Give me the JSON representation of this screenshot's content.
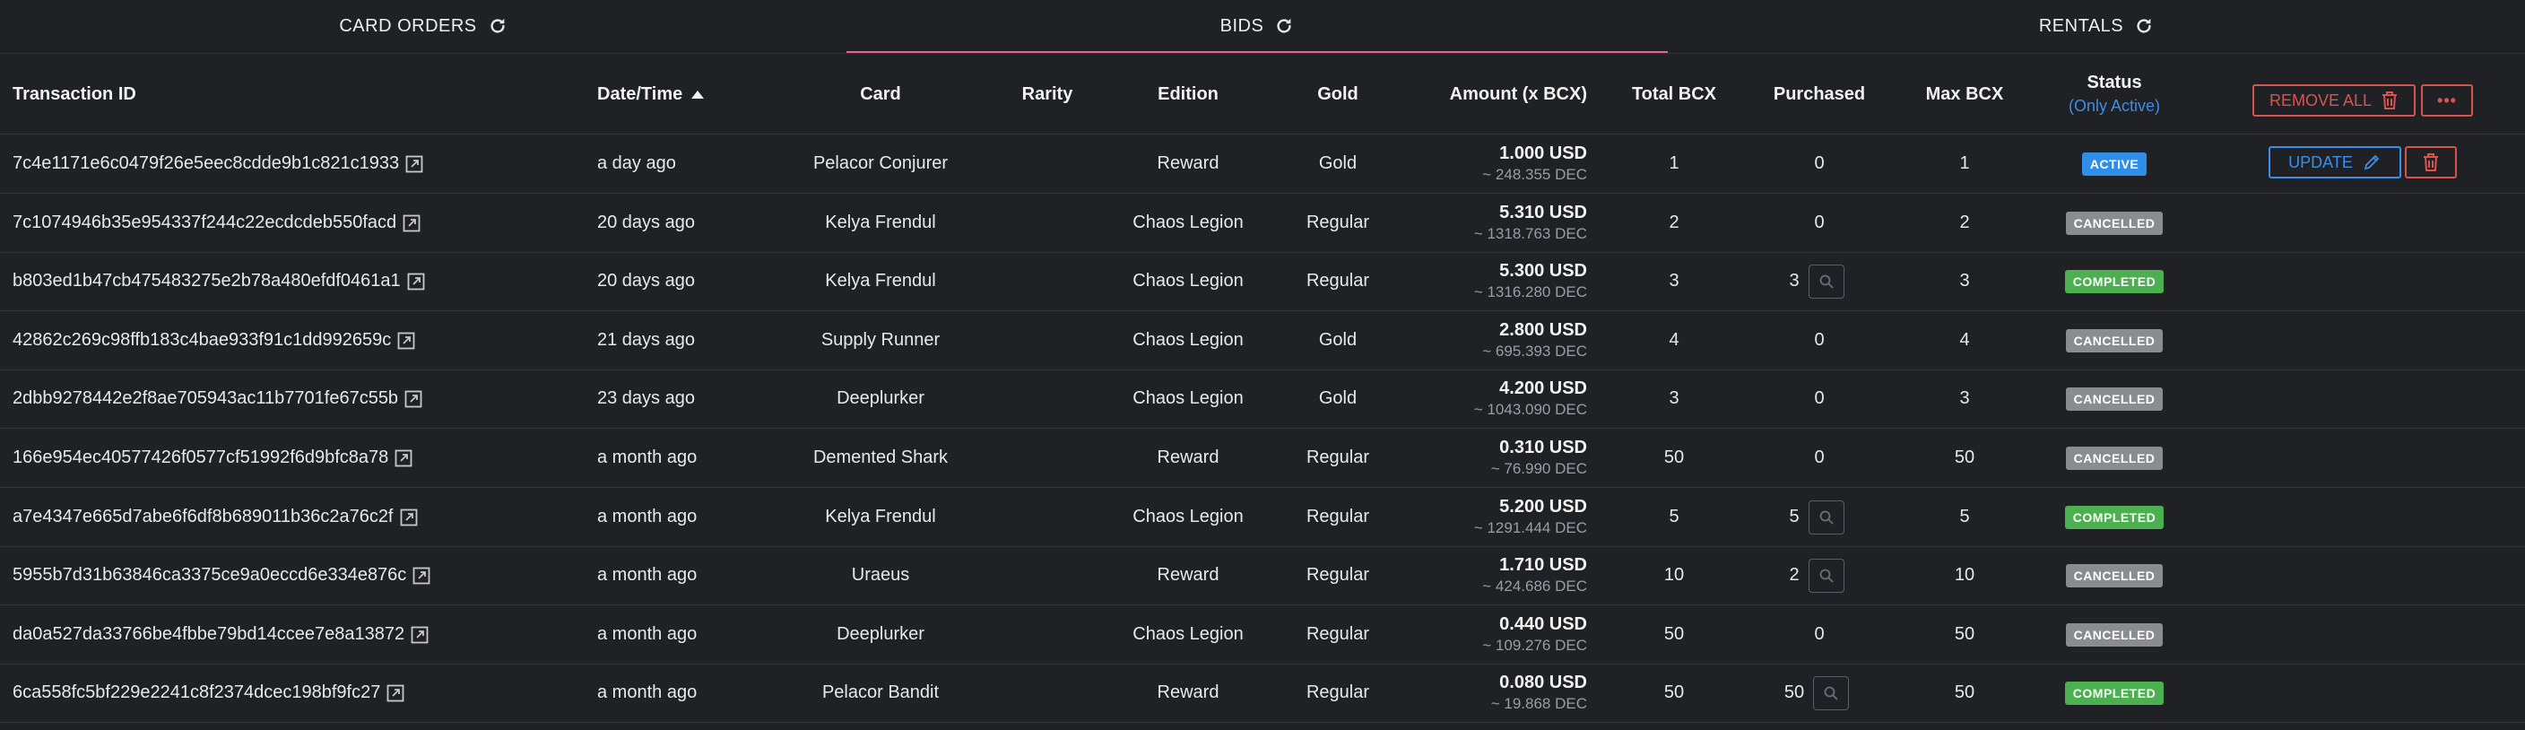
{
  "tabs": [
    {
      "label": "CARD ORDERS"
    },
    {
      "label": "BIDS"
    },
    {
      "label": "RENTALS"
    }
  ],
  "active_tab": "BIDS",
  "colors": {
    "accent_underline": "#e8678a",
    "danger": "#d9534f",
    "primary": "#3d8eea",
    "active": "#2f8fe8",
    "cancelled": "#8a8c8f",
    "completed": "#4caf50"
  },
  "columns": {
    "transaction_id": "Transaction ID",
    "datetime": "Date/Time",
    "card": "Card",
    "rarity": "Rarity",
    "edition": "Edition",
    "gold": "Gold",
    "amount": "Amount (x BCX)",
    "total_bcx": "Total BCX",
    "purchased": "Purchased",
    "max_bcx": "Max BCX",
    "status": "Status",
    "status_sub": "(Only Active)"
  },
  "actions": {
    "remove_all": "REMOVE ALL",
    "more": "•••",
    "update": "UPDATE"
  },
  "rows": [
    {
      "tx": "7c4e1171e6c0479f26e5eec8cdde9b1c821c1933",
      "time": "a day ago",
      "card": "Pelacor Conjurer",
      "rarity": "",
      "edition": "Reward",
      "gold": "Gold",
      "usd": "1.000 USD",
      "dec": "~ 248.355 DEC",
      "total": "1",
      "purchased": "0",
      "has_search": false,
      "max": "1",
      "status": "ACTIVE",
      "status_type": "active"
    },
    {
      "tx": "7c1074946b35e954337f244c22ecdcdeb550facd",
      "time": "20 days ago",
      "card": "Kelya Frendul",
      "rarity": "",
      "edition": "Chaos Legion",
      "gold": "Regular",
      "usd": "5.310 USD",
      "dec": "~ 1318.763 DEC",
      "total": "2",
      "purchased": "0",
      "has_search": false,
      "max": "2",
      "status": "CANCELLED",
      "status_type": "cancelled"
    },
    {
      "tx": "b803ed1b47cb475483275e2b78a480efdf0461a1",
      "time": "20 days ago",
      "card": "Kelya Frendul",
      "rarity": "",
      "edition": "Chaos Legion",
      "gold": "Regular",
      "usd": "5.300 USD",
      "dec": "~ 1316.280 DEC",
      "total": "3",
      "purchased": "3",
      "has_search": true,
      "max": "3",
      "status": "COMPLETED",
      "status_type": "completed"
    },
    {
      "tx": "42862c269c98ffb183c4bae933f91c1dd992659c",
      "time": "21 days ago",
      "card": "Supply Runner",
      "rarity": "",
      "edition": "Chaos Legion",
      "gold": "Gold",
      "usd": "2.800 USD",
      "dec": "~ 695.393 DEC",
      "total": "4",
      "purchased": "0",
      "has_search": false,
      "max": "4",
      "status": "CANCELLED",
      "status_type": "cancelled"
    },
    {
      "tx": "2dbb9278442e2f8ae705943ac11b7701fe67c55b",
      "time": "23 days ago",
      "card": "Deeplurker",
      "rarity": "",
      "edition": "Chaos Legion",
      "gold": "Gold",
      "usd": "4.200 USD",
      "dec": "~ 1043.090 DEC",
      "total": "3",
      "purchased": "0",
      "has_search": false,
      "max": "3",
      "status": "CANCELLED",
      "status_type": "cancelled"
    },
    {
      "tx": "166e954ec40577426f0577cf51992f6d9bfc8a78",
      "time": "a month ago",
      "card": "Demented Shark",
      "rarity": "",
      "edition": "Reward",
      "gold": "Regular",
      "usd": "0.310 USD",
      "dec": "~ 76.990 DEC",
      "total": "50",
      "purchased": "0",
      "has_search": false,
      "max": "50",
      "status": "CANCELLED",
      "status_type": "cancelled"
    },
    {
      "tx": "a7e4347e665d7abe6f6df8b689011b36c2a76c2f",
      "time": "a month ago",
      "card": "Kelya Frendul",
      "rarity": "",
      "edition": "Chaos Legion",
      "gold": "Regular",
      "usd": "5.200 USD",
      "dec": "~ 1291.444 DEC",
      "total": "5",
      "purchased": "5",
      "has_search": true,
      "max": "5",
      "status": "COMPLETED",
      "status_type": "completed"
    },
    {
      "tx": "5955b7d31b63846ca3375ce9a0eccd6e334e876c",
      "time": "a month ago",
      "card": "Uraeus",
      "rarity": "",
      "edition": "Reward",
      "gold": "Regular",
      "usd": "1.710 USD",
      "dec": "~ 424.686 DEC",
      "total": "10",
      "purchased": "2",
      "has_search": true,
      "max": "10",
      "status": "CANCELLED",
      "status_type": "cancelled"
    },
    {
      "tx": "da0a527da33766be4fbbe79bd14ccee7e8a13872",
      "time": "a month ago",
      "card": "Deeplurker",
      "rarity": "",
      "edition": "Chaos Legion",
      "gold": "Regular",
      "usd": "0.440 USD",
      "dec": "~ 109.276 DEC",
      "total": "50",
      "purchased": "0",
      "has_search": false,
      "max": "50",
      "status": "CANCELLED",
      "status_type": "cancelled"
    },
    {
      "tx": "6ca558fc5bf229e2241c8f2374dcec198bf9fc27",
      "time": "a month ago",
      "card": "Pelacor Bandit",
      "rarity": "",
      "edition": "Reward",
      "gold": "Regular",
      "usd": "0.080 USD",
      "dec": "~ 19.868 DEC",
      "total": "50",
      "purchased": "50",
      "has_search": true,
      "max": "50",
      "status": "COMPLETED",
      "status_type": "completed"
    }
  ]
}
